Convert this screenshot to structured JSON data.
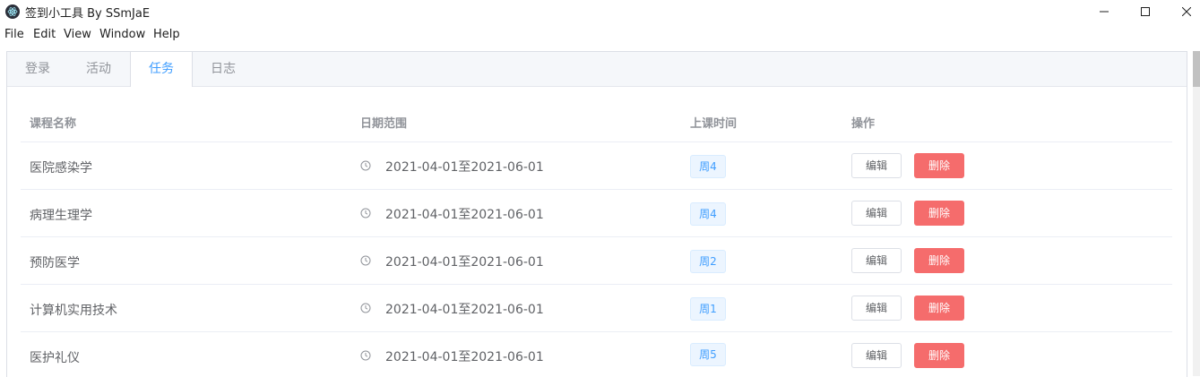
{
  "window": {
    "title": "签到小工具 By SSmJaE"
  },
  "menu": [
    "File",
    "Edit",
    "View",
    "Window",
    "Help"
  ],
  "tabs": [
    "登录",
    "活动",
    "任务",
    "日志"
  ],
  "active_tab": "任务",
  "table": {
    "headers": [
      "课程名称",
      "日期范围",
      "上课时间",
      "操作"
    ],
    "rows": [
      {
        "name": "医院感染学",
        "date": "2021-04-01至2021-06-01",
        "weekday": "周4",
        "edit": "编辑",
        "delete": "删除"
      },
      {
        "name": "病理生理学",
        "date": "2021-04-01至2021-06-01",
        "weekday": "周4",
        "edit": "编辑",
        "delete": "删除"
      },
      {
        "name": "预防医学",
        "date": "2021-04-01至2021-06-01",
        "weekday": "周2",
        "edit": "编辑",
        "delete": "删除"
      },
      {
        "name": "计算机实用技术",
        "date": "2021-04-01至2021-06-01",
        "weekday": "周1",
        "edit": "编辑",
        "delete": "删除"
      },
      {
        "name": "医护礼仪",
        "date": "2021-04-01至2021-06-01",
        "weekday": "周5",
        "edit": "编辑",
        "delete": "删除"
      }
    ]
  },
  "colors": {
    "primary": "#409eff",
    "danger": "#f56c6c",
    "tag_bg": "#ecf5ff",
    "tab_header_bg": "#f5f7fa"
  },
  "icons": {
    "app": "electron-logo-icon",
    "clock": "clock-icon",
    "minimize": "minimize-icon",
    "maximize": "maximize-icon",
    "close": "close-icon"
  }
}
